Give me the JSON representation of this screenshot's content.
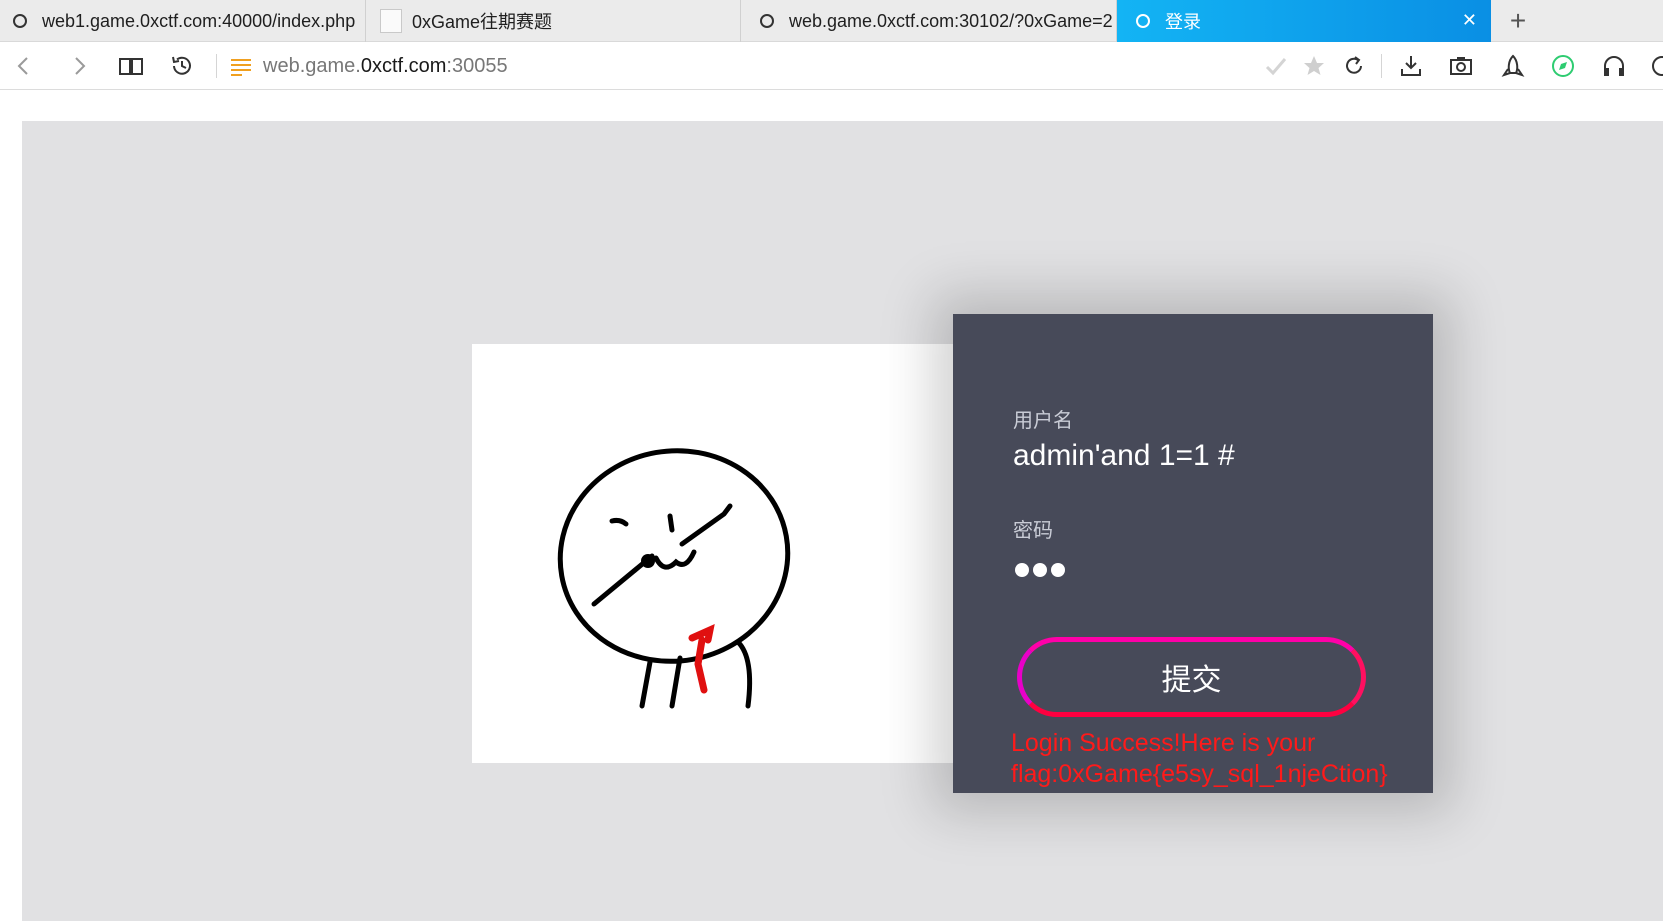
{
  "browser": {
    "tabs": [
      {
        "title": "web1.game.0xctf.com:40000/index.php",
        "active": false
      },
      {
        "title": "0xGame往期赛题",
        "active": false
      },
      {
        "title": "web.game.0xctf.com:30102/?0xGame=2",
        "active": false
      },
      {
        "title": "登录",
        "active": true
      }
    ],
    "url": {
      "prefix": "web.game.",
      "host": "0xctf.com",
      "suffix": ":30055"
    },
    "accent": "#0a8fe4"
  },
  "login": {
    "username_label": "用户名",
    "username_value": "admin'and 1=1 #",
    "password_label": "密码",
    "password_masked_length": 3,
    "submit_label": "提交",
    "result_message": "Login Success!Here is your flag:0xGame{e5sy_sql_1njeCtion}",
    "colors": {
      "panel": "#474a59",
      "button_border": "#ff1493",
      "message": "#ff1a1a"
    }
  }
}
